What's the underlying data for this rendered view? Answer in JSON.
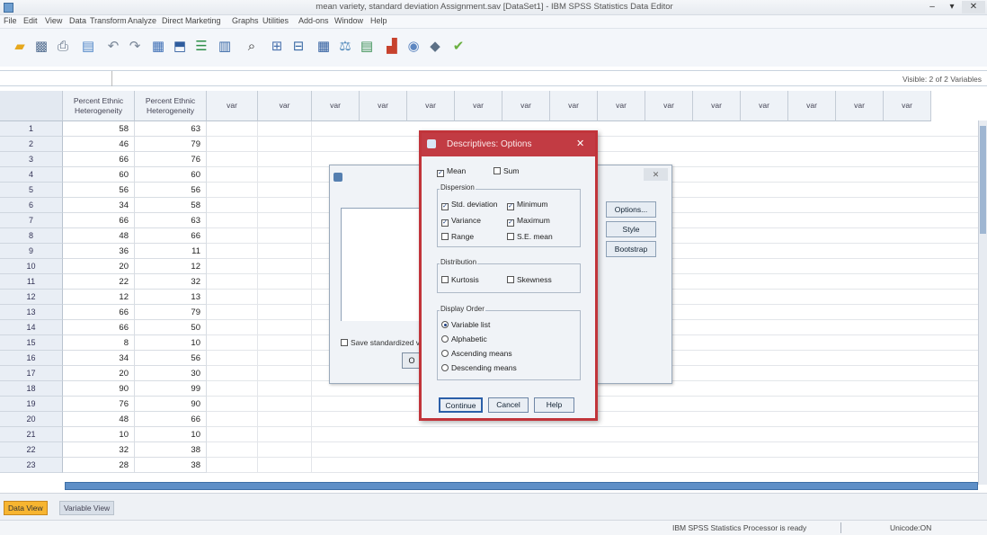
{
  "window": {
    "title": "mean variety, standard deviation Assignment.sav [DataSet1] - IBM SPSS Statistics Data Editor",
    "minimize": "–",
    "pin": "▾",
    "close": "✕"
  },
  "menu": [
    "File",
    "Edit",
    "View",
    "Data",
    "Transform",
    "Analyze",
    "Direct Marketing",
    "Graphs",
    "Utilities",
    "Add-ons",
    "Window",
    "Help"
  ],
  "toolbar": {
    "open": "open-folder-icon",
    "save": "save-icon",
    "print": "print-icon",
    "dialog_recall": "dialog-recall-icon",
    "undo": "undo-icon",
    "redo": "redo-icon",
    "goto_case": "goto-case-icon",
    "goto_variable": "goto-variable-icon",
    "variables": "variables-icon",
    "run_descriptives": "descriptives-icon",
    "find": "find-icon",
    "insert_cases": "insert-cases-icon",
    "insert_variable": "insert-variable-icon",
    "split_file": "split-file-icon",
    "weight_cases": "weight-cases-icon",
    "select_cases": "select-cases-icon",
    "value_labels": "value-labels-icon",
    "use_sets": "use-sets-icon",
    "show_all": "show-all-icon",
    "spell": "spell-icon"
  },
  "varbar": {
    "visible_text": "Visible: 2 of 2 Variables"
  },
  "grid": {
    "columns": [
      {
        "name": "Percent Ethnic Heterogeneity"
      },
      {
        "name": "Percent Ethnic Heterogeneity"
      }
    ],
    "empty_header_label": "var",
    "rows": [
      [
        "1",
        "58",
        "63"
      ],
      [
        "2",
        "46",
        "79"
      ],
      [
        "3",
        "66",
        "76"
      ],
      [
        "4",
        "60",
        "60"
      ],
      [
        "5",
        "56",
        "56"
      ],
      [
        "6",
        "34",
        "58"
      ],
      [
        "7",
        "66",
        "63"
      ],
      [
        "8",
        "48",
        "66"
      ],
      [
        "9",
        "36",
        "11"
      ],
      [
        "10",
        "20",
        "12"
      ],
      [
        "11",
        "22",
        "32"
      ],
      [
        "12",
        "12",
        "13"
      ],
      [
        "13",
        "66",
        "79"
      ],
      [
        "14",
        "66",
        "50"
      ],
      [
        "15",
        "8",
        "10"
      ],
      [
        "16",
        "34",
        "56"
      ],
      [
        "17",
        "20",
        "30"
      ],
      [
        "18",
        "90",
        "99"
      ],
      [
        "19",
        "76",
        "90"
      ],
      [
        "20",
        "48",
        "66"
      ],
      [
        "21",
        "10",
        "10"
      ],
      [
        "22",
        "32",
        "38"
      ],
      [
        "23",
        "28",
        "38"
      ]
    ]
  },
  "tabs": {
    "data_view": "Data View",
    "variable_view": "Variable View"
  },
  "status": {
    "processor": "IBM SPSS Statistics Processor is ready",
    "unicode": "Unicode:ON"
  },
  "background_dialog": {
    "close": "✕",
    "save_check": "Save standardized values as variables",
    "ok_partial": "O",
    "side_buttons": [
      "Options...",
      "Style",
      "Bootstrap"
    ]
  },
  "options_dialog": {
    "title": "Descriptives: Options",
    "close": "✕",
    "mean": "Mean",
    "sum": "Sum",
    "dispersion_label": "Dispersion",
    "dispersion": [
      {
        "label": "Std. deviation",
        "checked": true
      },
      {
        "label": "Minimum",
        "checked": true
      },
      {
        "label": "Variance",
        "checked": true
      },
      {
        "label": "Maximum",
        "checked": true
      },
      {
        "label": "Range",
        "checked": false
      },
      {
        "label": "S.E. mean",
        "checked": false
      }
    ],
    "distribution_label": "Distribution",
    "distribution": [
      {
        "label": "Kurtosis",
        "checked": false
      },
      {
        "label": "Skewness",
        "checked": false
      }
    ],
    "display_order_label": "Display Order",
    "display_order": [
      {
        "label": "Variable list",
        "selected": true
      },
      {
        "label": "Alphabetic",
        "selected": false
      },
      {
        "label": "Ascending means",
        "selected": false
      },
      {
        "label": "Descending means",
        "selected": false
      }
    ],
    "buttons": {
      "continue": "Continue",
      "cancel": "Cancel",
      "help": "Help"
    }
  }
}
